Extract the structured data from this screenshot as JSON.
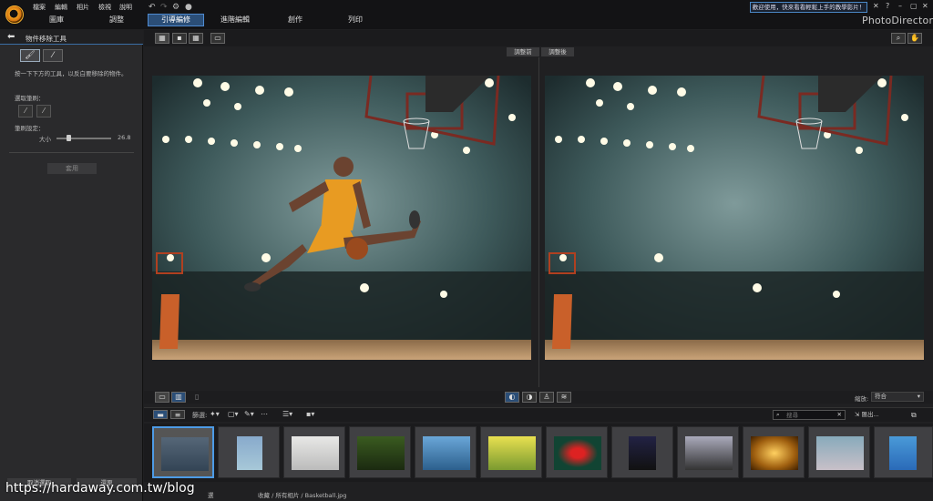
{
  "menu": [
    "檔案",
    "編輯",
    "相片",
    "檢視",
    "說明"
  ],
  "main_tabs": [
    "圖庫",
    "調整",
    "引導編修",
    "進階編輯",
    "創作",
    "列印"
  ],
  "welcome_text": "歡迎使用，快來看看輕鬆上手的教學影片！",
  "window_controls": [
    "✕",
    "?",
    "–",
    "▢",
    "✕"
  ],
  "brand": "PhotoDirector",
  "left_panel": {
    "title": "物件移除工具",
    "description": "按一下下方的工具，以反白要移除的物件。",
    "brush_select_label": "選取筆刷：",
    "brush_settings_label": "筆刷設定：",
    "size_label": "大小",
    "size_value": "26.8",
    "size_fraction": 0.22,
    "apply_label": "套用",
    "bottom_btn1": "取消選取",
    "bottom_btn2": "還原"
  },
  "viewer": {
    "before_label": "調整前",
    "after_label": "調整後",
    "zoom_label": "縮放:",
    "zoom_value": "符合"
  },
  "filmbar": {
    "filter_label": "篩選:",
    "search_placeholder": "搜尋",
    "export_label": "匯出..."
  },
  "status": {
    "path": "收藏 / 所有相片 / Basketball.jpg",
    "selected_suffix": "選"
  },
  "watermark": "https://hardaway.com.tw/blog",
  "colors": {
    "accent": "#4d9be6",
    "tab_active_bg": "#2b4e77",
    "panel_bg": "#2a2a2c"
  }
}
